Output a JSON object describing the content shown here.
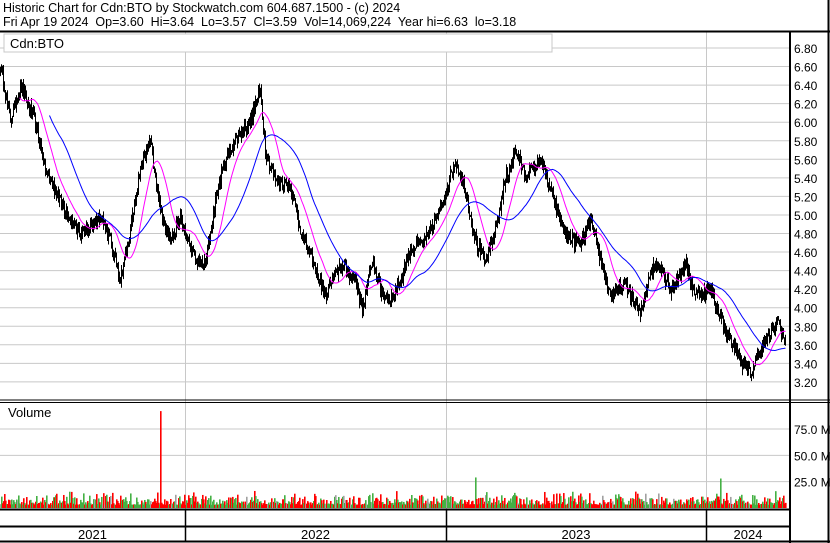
{
  "header": {
    "title": "Historic Chart for Cdn:BTO by Stockwatch.com 604.687.1500 - (c) 2024",
    "quote": "Fri Apr 19 2024  Op=3.60  Hi=3.64  Lo=3.57  Cl=3.59  Vol=14,069,224  Year hi=6.63  lo=3.18"
  },
  "chart_data": {
    "type": "line",
    "symbol_label": "Cdn:BTO",
    "volume_label": "Volume",
    "price_ticks": [
      "6.80",
      "6.60",
      "6.40",
      "6.20",
      "6.00",
      "5.80",
      "5.60",
      "5.40",
      "5.20",
      "5.00",
      "4.80",
      "4.60",
      "4.40",
      "4.20",
      "4.00",
      "3.80",
      "3.60",
      "3.40",
      "3.20"
    ],
    "ylim": [
      3.0,
      6.9
    ],
    "volume_ticks": [
      "75.0 M",
      "50.0 M",
      "25.0 M"
    ],
    "volume_tick_values": [
      75,
      50,
      25
    ],
    "years": [
      {
        "label": "2021",
        "start_day": 0,
        "end_day": 185
      },
      {
        "label": "2022",
        "start_day": 185,
        "end_day": 446
      },
      {
        "label": "2023",
        "start_day": 446,
        "end_day": 706
      },
      {
        "label": "2024",
        "start_day": 706,
        "end_day": 790
      }
    ],
    "price_waypoints": [
      [
        0,
        6.62
      ],
      [
        10,
        6.02
      ],
      [
        20,
        6.4
      ],
      [
        35,
        6.0
      ],
      [
        45,
        5.48
      ],
      [
        60,
        5.16
      ],
      [
        80,
        4.78
      ],
      [
        100,
        5.0
      ],
      [
        110,
        4.73
      ],
      [
        120,
        4.3
      ],
      [
        130,
        4.84
      ],
      [
        140,
        5.48
      ],
      [
        150,
        5.81
      ],
      [
        160,
        5.05
      ],
      [
        170,
        4.73
      ],
      [
        180,
        4.95
      ],
      [
        195,
        4.52
      ],
      [
        205,
        4.46
      ],
      [
        215,
        5.16
      ],
      [
        225,
        5.6
      ],
      [
        235,
        5.81
      ],
      [
        250,
        6.02
      ],
      [
        260,
        6.35
      ],
      [
        265,
        5.7
      ],
      [
        275,
        5.38
      ],
      [
        290,
        5.32
      ],
      [
        300,
        4.84
      ],
      [
        315,
        4.41
      ],
      [
        325,
        4.14
      ],
      [
        340,
        4.46
      ],
      [
        355,
        4.3
      ],
      [
        362,
        3.98
      ],
      [
        372,
        4.52
      ],
      [
        380,
        4.19
      ],
      [
        390,
        4.08
      ],
      [
        400,
        4.3
      ],
      [
        410,
        4.62
      ],
      [
        425,
        4.73
      ],
      [
        440,
        5.05
      ],
      [
        455,
        5.59
      ],
      [
        465,
        5.27
      ],
      [
        475,
        4.73
      ],
      [
        485,
        4.46
      ],
      [
        495,
        4.84
      ],
      [
        505,
        5.38
      ],
      [
        515,
        5.7
      ],
      [
        525,
        5.43
      ],
      [
        540,
        5.59
      ],
      [
        550,
        5.27
      ],
      [
        565,
        4.78
      ],
      [
        580,
        4.68
      ],
      [
        590,
        4.95
      ],
      [
        600,
        4.52
      ],
      [
        610,
        4.14
      ],
      [
        625,
        4.25
      ],
      [
        640,
        3.92
      ],
      [
        650,
        4.41
      ],
      [
        660,
        4.46
      ],
      [
        670,
        4.19
      ],
      [
        685,
        4.46
      ],
      [
        695,
        4.14
      ],
      [
        710,
        4.19
      ],
      [
        725,
        3.76
      ],
      [
        740,
        3.44
      ],
      [
        750,
        3.28
      ],
      [
        760,
        3.55
      ],
      [
        770,
        3.71
      ],
      [
        778,
        3.87
      ],
      [
        785,
        3.59
      ]
    ],
    "moving_averages": [
      {
        "name": "short MA",
        "period": 20,
        "color": "#ff00ff"
      },
      {
        "name": "long MA",
        "period": 50,
        "color": "#0000ff"
      }
    ],
    "volume_spikes_millions": [
      [
        160,
        92
      ],
      [
        475,
        29
      ],
      [
        720,
        28
      ]
    ],
    "colors": {
      "up": "#44b044",
      "down": "#ff0000",
      "flat": "#a0a0a0",
      "grid": "#c8c8c8"
    }
  }
}
